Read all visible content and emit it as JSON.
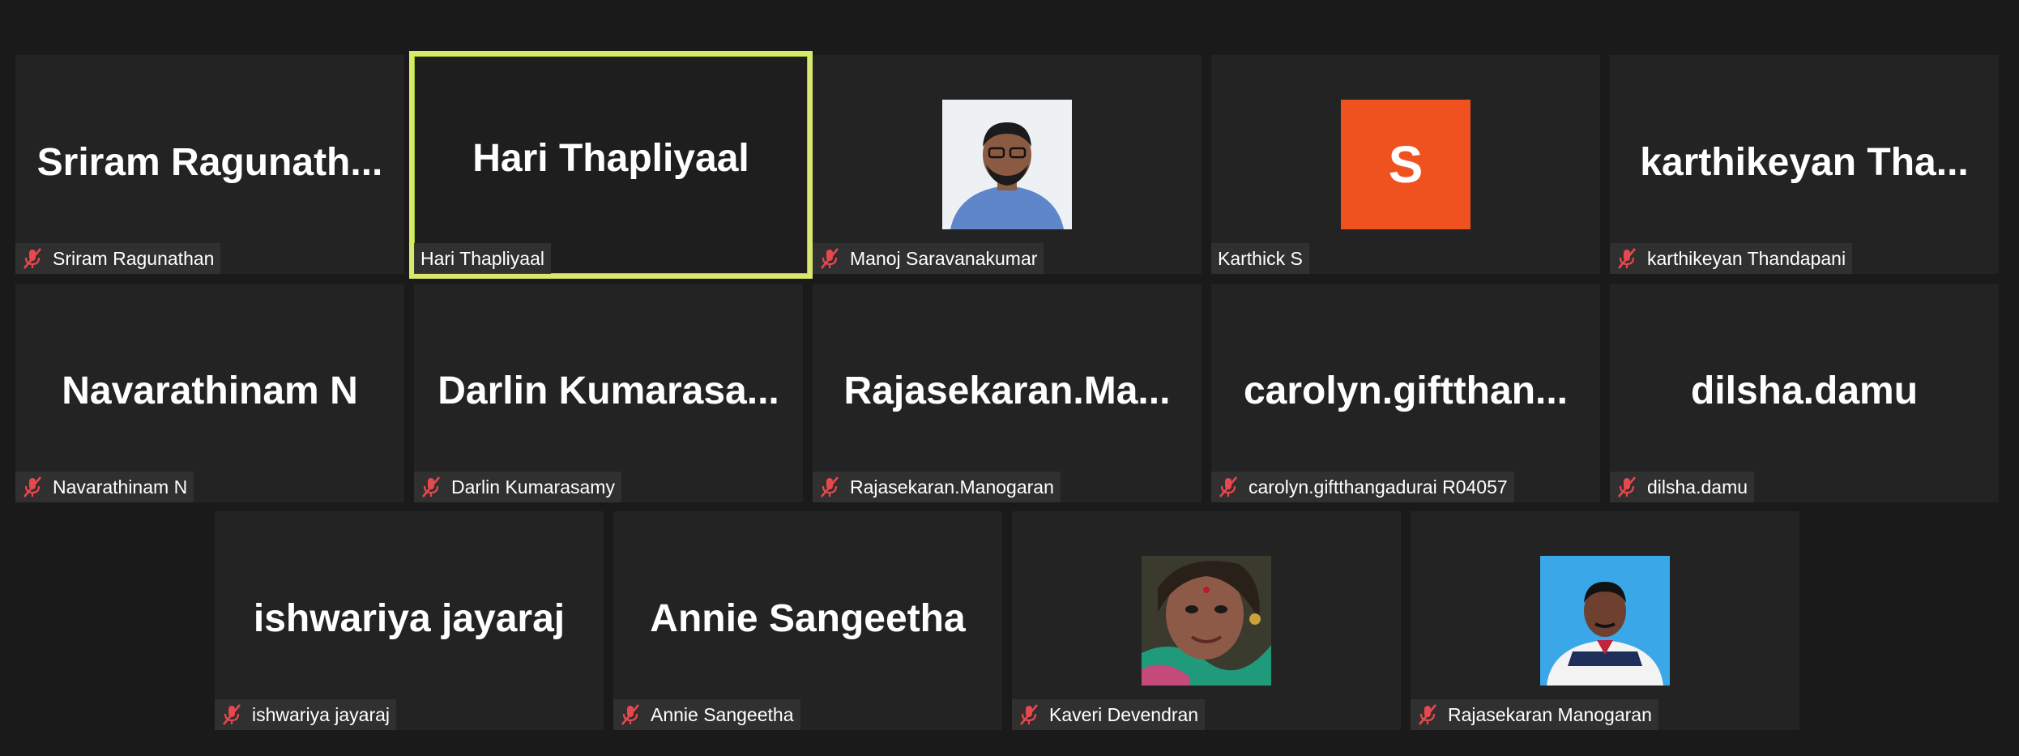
{
  "accent_colors": {
    "active_speaker_border": "#d9e86a",
    "muted_icon": "#e5484d",
    "letter_avatar_bg": "#f0521f"
  },
  "participants": [
    {
      "display": "Sriram  Ragunath...",
      "label": "Sriram Ragunathan",
      "muted": true,
      "avatar": "none"
    },
    {
      "display": "Hari Thapliyaal",
      "label": "Hari Thapliyaal",
      "muted": false,
      "avatar": "none",
      "active": true
    },
    {
      "display": "",
      "label": "Manoj Saravanakumar",
      "muted": true,
      "avatar": "photo-man-glasses"
    },
    {
      "display": "",
      "label": "Karthick S",
      "muted": false,
      "avatar": "letter",
      "letter": "S"
    },
    {
      "display": "karthikeyan  Tha...",
      "label": "karthikeyan Thandapani",
      "muted": true,
      "avatar": "none"
    },
    {
      "display": "Navarathinam N",
      "label": "Navarathinam N",
      "muted": true,
      "avatar": "none"
    },
    {
      "display": "Darlin  Kumarasa...",
      "label": "Darlin Kumarasamy",
      "muted": true,
      "avatar": "none"
    },
    {
      "display": "Rajasekaran.Ma...",
      "label": "Rajasekaran.Manogaran",
      "muted": true,
      "avatar": "none"
    },
    {
      "display": "carolyn.giftthan...",
      "label": "carolyn.giftthangadurai R04057",
      "muted": true,
      "avatar": "none"
    },
    {
      "display": "dilsha.damu",
      "label": "dilsha.damu",
      "muted": true,
      "avatar": "none"
    },
    {
      "display": "ishwariya jayaraj",
      "label": "ishwariya jayaraj",
      "muted": true,
      "avatar": "none"
    },
    {
      "display": "Annie Sangeetha",
      "label": "Annie Sangeetha",
      "muted": true,
      "avatar": "none"
    },
    {
      "display": "",
      "label": "Kaveri Devendran",
      "muted": true,
      "avatar": "photo-woman"
    },
    {
      "display": "",
      "label": "Rajasekaran Manogaran",
      "muted": true,
      "avatar": "photo-man-blue-bg"
    }
  ]
}
